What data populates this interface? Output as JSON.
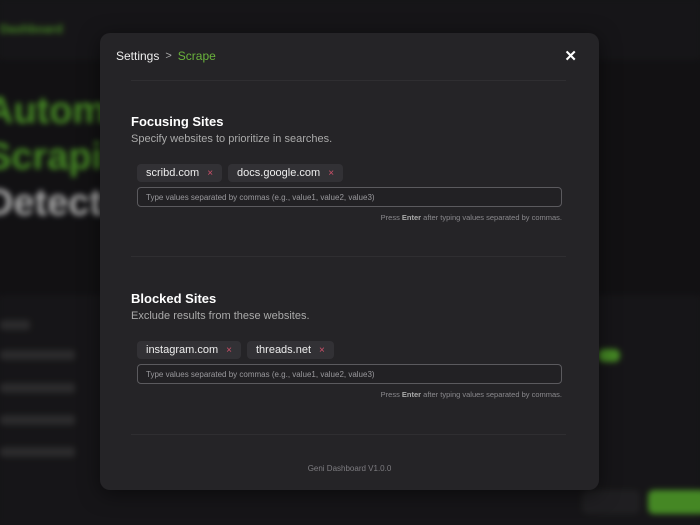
{
  "background": {
    "brand": "Dashboard",
    "hero_lines": [
      "Automa",
      "Scrapin",
      "Detecti"
    ]
  },
  "modal": {
    "breadcrumb": {
      "parent": "Settings",
      "separator": ">",
      "current": "Scrape"
    },
    "sections": [
      {
        "title": "Focusing Sites",
        "subtitle": "Specify websites to prioritize in searches.",
        "chips": [
          "scribd.com",
          "docs.google.com"
        ],
        "placeholder": "Type values separated by commas (e.g., value1, value2, value3)",
        "hint_pre": "Press ",
        "hint_key": "Enter",
        "hint_post": " after typing values separated by commas."
      },
      {
        "title": "Blocked Sites",
        "subtitle": "Exclude results from these websites.",
        "chips": [
          "instagram.com",
          "threads.net"
        ],
        "placeholder": "Type values separated by commas (e.g., value1, value2, value3)",
        "hint_pre": "Press ",
        "hint_key": "Enter",
        "hint_post": " after typing values separated by commas."
      }
    ],
    "chip_remove": "×",
    "close": "✕",
    "footer": "Geni Dashboard V1.0.0"
  },
  "colors": {
    "accent": "#6ab33c",
    "remove": "#d0506a"
  }
}
